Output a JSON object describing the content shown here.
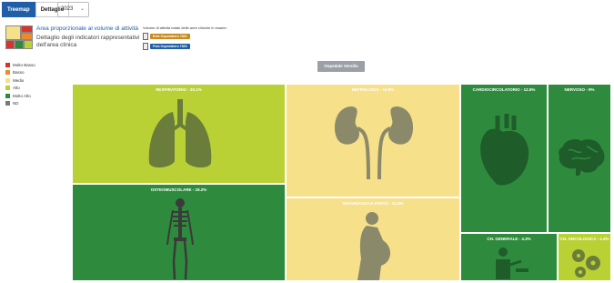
{
  "tabs": [
    {
      "label": "Treemap",
      "active": true
    },
    {
      "label": "Dettaglio",
      "active": false
    }
  ],
  "year": {
    "value": "2023"
  },
  "info": {
    "area_text": "Area proporzionale al volume di attività",
    "detail_text": "Dettaglio degli indicatori rappresentativi dell'area clinica"
  },
  "volume": {
    "title": "Volume di attività totale delle aree cliniche in esame:",
    "entity1": {
      "label": "Ente Ospedaliero 7820",
      "color": "#e8922a"
    },
    "entity2": {
      "label": "Polo Ospedaliero 7820",
      "color": "#1f5fa8"
    }
  },
  "legend": [
    {
      "label": "Molto Basso",
      "color": "#d9342b"
    },
    {
      "label": "Basso",
      "color": "#ef8a2a"
    },
    {
      "label": "Medio",
      "color": "#f7e08a"
    },
    {
      "label": "Alto",
      "color": "#b9d135"
    },
    {
      "label": "Molto Alto",
      "color": "#2e8b3d"
    },
    {
      "label": "ND",
      "color": "#7a7a7a"
    }
  ],
  "hospital_button": "Ospedale Versilia",
  "treemap": {
    "respiratorio": {
      "label": "RESPIRATORIO - 20.1%",
      "level": "Alto",
      "icon": "lungs-icon"
    },
    "osteomuscolare": {
      "label": "OSTEOMUSCOLARE - 19.2%",
      "level": "Molto Alto",
      "icon": "skeleton-icon"
    },
    "nefrologia": {
      "label": "NEFROLOGIA - 16.8%",
      "level": "Medio",
      "icon": "kidneys-icon"
    },
    "gravidanza": {
      "label": "GRAVIDANZA E PARTO - 13.4%",
      "level": "Medio",
      "icon": "pregnancy-icon"
    },
    "cardio": {
      "label": "CARDIOCIRCOLATORIO - 12.5%",
      "level": "Molto Alto",
      "icon": "heart-icon"
    },
    "nervoso": {
      "label": "NERVOSO - 9%",
      "level": "Molto Alto",
      "icon": "brain-icon"
    },
    "chgenerale": {
      "label": "CH. GENERALE - 4.3%",
      "level": "Molto Alto",
      "icon": "surgeon-icon"
    },
    "choncologica": {
      "label": "CH. ONCOLOGICA - 2.4%",
      "level": "Alto",
      "icon": "cells-icon"
    }
  }
}
